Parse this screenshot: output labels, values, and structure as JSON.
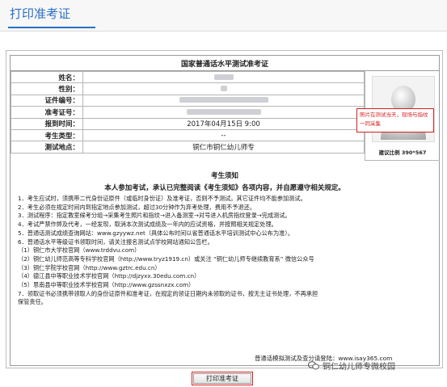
{
  "header": {
    "tab_label": "打印准考证"
  },
  "card": {
    "title": "国家普通话水平测试准考证",
    "fields": [
      {
        "label": "姓名：",
        "value": ""
      },
      {
        "label": "性别：",
        "value": ""
      },
      {
        "label": "证件编号：",
        "value": ""
      },
      {
        "label": "准考证号：",
        "value": ""
      },
      {
        "label": "报到时间：",
        "value": "2017年04月15日 9:00"
      },
      {
        "label": "考生类型：",
        "value": "--"
      },
      {
        "label": "测试地点：",
        "value": "铜仁市铜仁幼儿师专"
      }
    ],
    "photo_caption": "建议比例 390*567"
  },
  "annotation": {
    "text": "照片在测试当天，现场与指纹一同采集"
  },
  "notice": {
    "title": "考生须知",
    "subtitle": "本人参加考试，承认已完整阅读《考生须知》各项内容，并自愿遵守相关规定。",
    "lines": [
      "1．考生应试时，须携带二代身份证原件（或临时身份证）及准考证，否则不予测试。其它证件均不能参加测试。",
      "2．考生必须在规定时间内到指定地点参加测试，超过30分钟作为弃考处理，费用不予退还。",
      "3．测试程序：指定教室候考分组→采集考生照片和指纹→进入备测室→对号进入机房指纹登录→完成测试。",
      "4．考试严禁作弊及代考，一经发现，取消本次测试成绩及一年内的应试资格，并按照相关规定处理。",
      "5．普通话测试成绩查询网站：www.gzyywz.net（具体公布时间以省普通话水平培训测试中心公布为准）。",
      "6．普通话水平等级证书领取时间，请关注报名测试点学校网站通知公告栏。",
      "（1）铜仁市大学校官网（www.trddvu.com）",
      "（2）铜仁幼儿师范高等专科学校官网（http://www.tryz1919.cn）或关注 “铜仁幼儿师专继续教育系” 微信公众号",
      "（3）铜仁学院学校官网（http://www.gztrc.edu.cn）",
      "（4）德江县中等职业技术学校官网（http://djzyxx.30edu.com.cn）",
      "（5）思南县中等职业技术学校官网（http://www.gzssnxzx.com）",
      "7．领取证书必须携带领取人的身份证原件和准考证，在规定的领证日期内未领取的证书，按无主证书处理，不再承担",
      "保管责任。"
    ],
    "footer": "普通话模拟测试及查分请登陆：www.isay365.com"
  },
  "watermark": "铜仁幼儿师专微校园",
  "print_button_label": "打印准考证"
}
